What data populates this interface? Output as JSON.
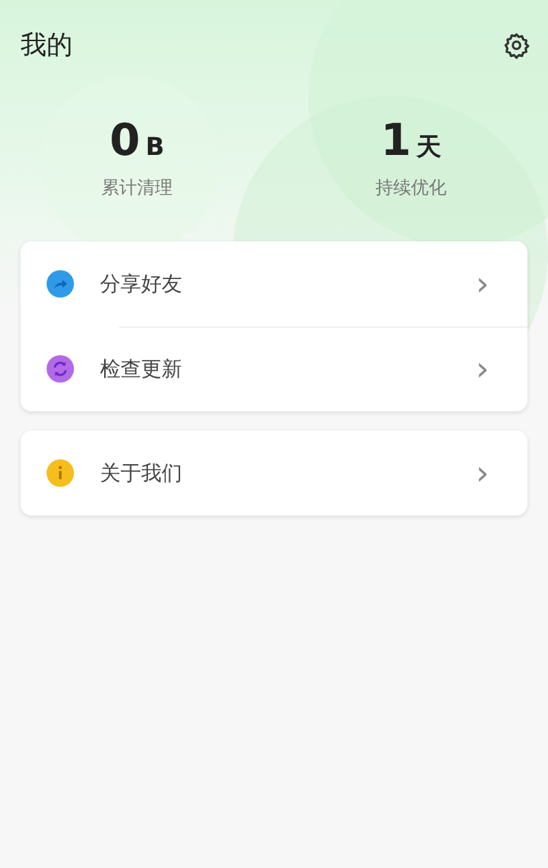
{
  "header": {
    "title": "我的"
  },
  "stats": [
    {
      "value": "0",
      "unit": "B",
      "label": "累计清理"
    },
    {
      "value": "1",
      "unit": "天",
      "label": "持续优化"
    }
  ],
  "menu_groups": [
    {
      "items": [
        {
          "kind": "share",
          "label": "分享好友",
          "chevron": "›"
        },
        {
          "kind": "update",
          "label": "检查更新",
          "chevron": "›"
        }
      ]
    },
    {
      "items": [
        {
          "kind": "info",
          "label": "关于我们",
          "chevron": "›"
        }
      ]
    }
  ]
}
